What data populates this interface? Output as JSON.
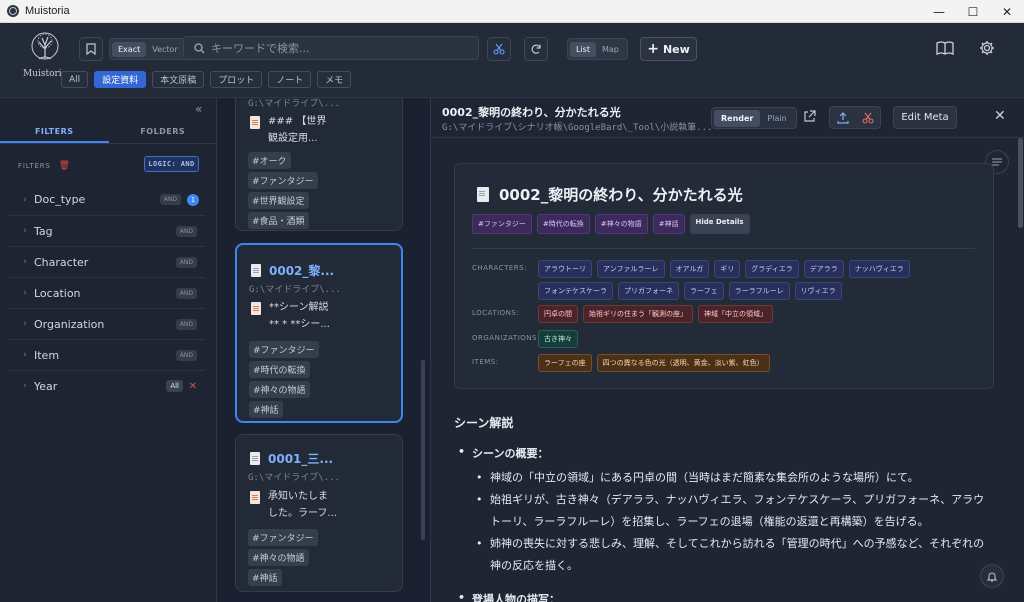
{
  "window": {
    "title": "Muistoria",
    "controls": [
      "—",
      "☐",
      "✕"
    ]
  },
  "header": {
    "logo_text": "Muistoria",
    "search_mode": {
      "options": [
        "Exact",
        "Vector"
      ],
      "selected": "Exact"
    },
    "search_placeholder": "キーワードで検索...",
    "view_mode": {
      "options": [
        "List",
        "Map"
      ],
      "selected": "List"
    },
    "new_label": "New",
    "categories": [
      {
        "label": "All",
        "active": false
      },
      {
        "label": "設定資料",
        "active": true
      },
      {
        "label": "本文原稿",
        "active": false
      },
      {
        "label": "プロット",
        "active": false
      },
      {
        "label": "ノート",
        "active": false
      },
      {
        "label": "メモ",
        "active": false
      }
    ]
  },
  "sidebar": {
    "tabs": [
      "FILTERS",
      "FOLDERS"
    ],
    "active_tab": "FILTERS",
    "filters_label": "FILTERS",
    "logic_label": "LOGIC: AND",
    "facets": [
      {
        "name": "Doc_type",
        "badge": "AND",
        "count": "1"
      },
      {
        "name": "Tag",
        "badge": "AND"
      },
      {
        "name": "Character",
        "badge": "AND"
      },
      {
        "name": "Location",
        "badge": "AND"
      },
      {
        "name": "Organization",
        "badge": "AND"
      },
      {
        "name": "Item",
        "badge": "AND"
      },
      {
        "name": "Year",
        "badge": "All"
      }
    ]
  },
  "list": {
    "cards": [
      {
        "title": "",
        "path": "G:\\マイドライブ\\...",
        "excerpt": [
          "### 【世界",
          "観設定用..."
        ],
        "tags": [
          "#オーク",
          "#ファンタジー",
          "#世界観設定",
          "#食品・酒類"
        ]
      },
      {
        "title": "0002_黎...",
        "path": "G:\\マイドライブ\\...",
        "excerpt": [
          "**シーン解説",
          "** * **シー..."
        ],
        "tags": [
          "#ファンタジー",
          "#時代の転換",
          "#神々の物語",
          "#神話"
        ]
      },
      {
        "title": "0001_三...",
        "path": "G:\\マイドライブ\\...",
        "excerpt": [
          "承知いたしま",
          "した。ラーフ..."
        ],
        "tags": [
          "#ファンタジー",
          "#神々の物語",
          "#神話"
        ]
      }
    ]
  },
  "detail": {
    "title": "0002_黎明の終わり、分かたれる光",
    "path": "G:\\マイドライブ\\シナリオ帳\\GoogleBard\\_Tool\\小説執筆...",
    "render_options": [
      "Render",
      "Plain"
    ],
    "render_selected": "Render",
    "edit_meta_label": "Edit Meta",
    "meta": {
      "title": "0002_黎明の終わり、分かたれる光",
      "tags": [
        "#ファンタジー",
        "#時代の転換",
        "#神々の物語",
        "#神話"
      ],
      "hide_details": "Hide Details",
      "characters_label": "CHARACTERS:",
      "characters": [
        "アラウトーリ",
        "アンファルラーレ",
        "オアルガ",
        "ギリ",
        "グラディエラ",
        "デアララ",
        "ナッハヴィエラ",
        "フォンテケスケーラ",
        "プリガフォーネ",
        "ラーフェ",
        "ラーラフルーレ",
        "リヴィエラ"
      ],
      "locations_label": "LOCATIONS:",
      "locations": [
        "円卓の間",
        "始祖ギリの住まう「観測の座」",
        "神域「中立の領域」"
      ],
      "organizations_label": "ORGANIZATIONS:",
      "organizations": [
        "古き神々"
      ],
      "items_label": "ITEMS:",
      "items": [
        "ラーフェの座",
        "四つの異なる色の光（透明、黄金、淡い紫、虹色）"
      ]
    },
    "body": {
      "heading": "シーン解説",
      "section1": "シーンの概要：",
      "bullets": [
        "神域の「中立の領域」にある円卓の間（当時はまだ簡素な集会所のような場所）にて。",
        "始祖ギリが、古き神々（デアララ、ナッハヴィエラ、フォンテケスケーラ、プリガフォーネ、アラウトーリ、ラーラフルーレ）を招集し、ラーフェの退場（権能の返還と再構築）を告げる。",
        "姉神の喪失に対する悲しみ、理解、そしてこれから訪れる「管理の時代」への予感など、それぞれの神の反応を描く。"
      ],
      "section2": "登場人物の描写："
    }
  }
}
